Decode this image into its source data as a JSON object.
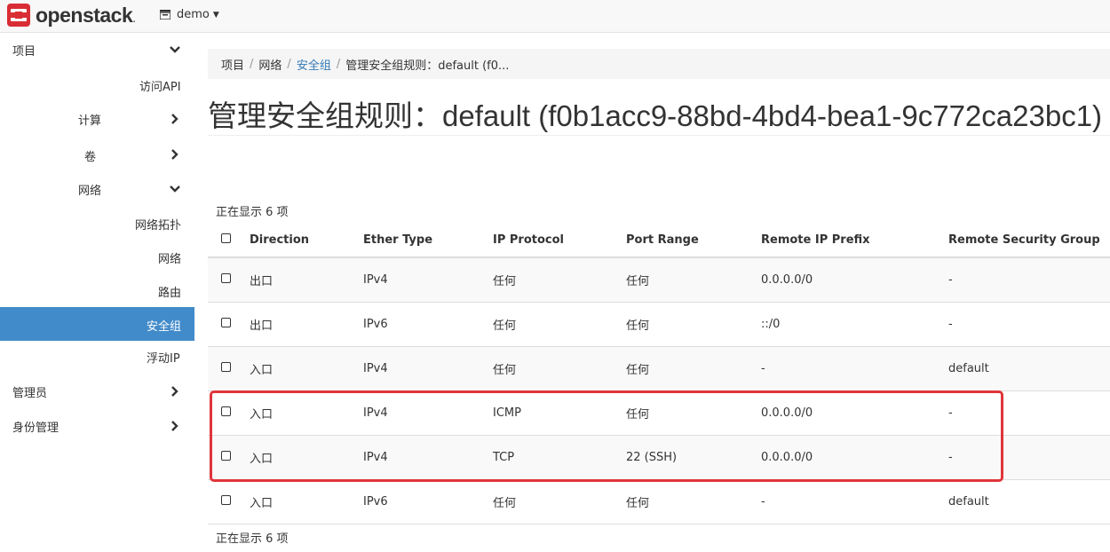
{
  "brand": {
    "name": "openstack",
    "trademark": "."
  },
  "project": {
    "current": "demo"
  },
  "sidebar": {
    "project": "项目",
    "access_api": "访问API",
    "compute": "计算",
    "volumes": "卷",
    "network": "网络",
    "network_topology": "网络拓扑",
    "networks": "网络",
    "routers": "路由",
    "security_groups": "安全组",
    "floating_ips": "浮动IP",
    "admin": "管理员",
    "identity": "身份管理"
  },
  "breadcrumb": {
    "project": "项目",
    "network": "网络",
    "security_groups": "安全组",
    "current": "管理安全组规则：default (f0..."
  },
  "page": {
    "title": "管理安全组规则：default (f0b1acc9-88bd-4bd4-bea1-9c772ca23bc1)"
  },
  "table": {
    "count_text": "正在显示 6 项",
    "headers": [
      "Direction",
      "Ether Type",
      "IP Protocol",
      "Port Range",
      "Remote IP Prefix",
      "Remote Security Group"
    ],
    "rows": [
      [
        "出口",
        "IPv4",
        "任何",
        "任何",
        "0.0.0.0/0",
        "-"
      ],
      [
        "出口",
        "IPv6",
        "任何",
        "任何",
        "::/0",
        "-"
      ],
      [
        "入口",
        "IPv4",
        "任何",
        "任何",
        "-",
        "default"
      ],
      [
        "入口",
        "IPv4",
        "ICMP",
        "任何",
        "0.0.0.0/0",
        "-"
      ],
      [
        "入口",
        "IPv4",
        "TCP",
        "22 (SSH)",
        "0.0.0.0/0",
        "-"
      ],
      [
        "入口",
        "IPv6",
        "任何",
        "任何",
        "-",
        "default"
      ]
    ]
  },
  "colors": {
    "accent": "#428bca",
    "link": "#337ab7",
    "highlight": "#e0353a",
    "logo": "#d92d35"
  }
}
